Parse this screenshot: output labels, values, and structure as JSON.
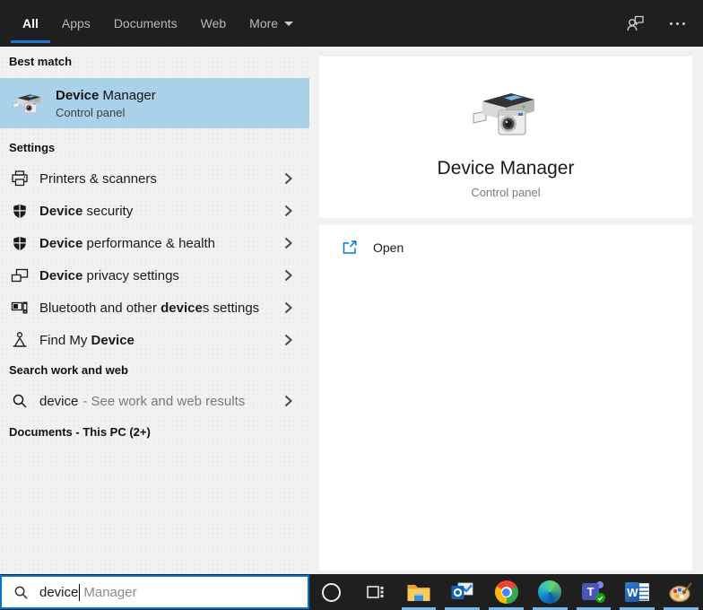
{
  "header": {
    "tabs": [
      {
        "label": "All"
      },
      {
        "label": "Apps"
      },
      {
        "label": "Documents"
      },
      {
        "label": "Web"
      },
      {
        "label": "More"
      }
    ]
  },
  "left_panel": {
    "best_match_label": "Best match",
    "best_match": {
      "title_bold": "Device",
      "title_rest": " Manager",
      "subtitle": "Control panel"
    },
    "settings_label": "Settings",
    "settings_items": [
      {
        "pre": "Printers & scanners",
        "bold": "",
        "post": ""
      },
      {
        "pre": "",
        "bold": "Device",
        "post": " security"
      },
      {
        "pre": "",
        "bold": "Device",
        "post": " performance & health"
      },
      {
        "pre": "",
        "bold": "Device",
        "post": " privacy settings"
      },
      {
        "pre": "Bluetooth and other ",
        "bold": "device",
        "post": "s settings"
      },
      {
        "pre": "Find My ",
        "bold": "Device",
        "post": ""
      }
    ],
    "web_search_label": "Search work and web",
    "web_search": {
      "query": "device",
      "rest": "- See work and web results"
    },
    "documents_label": "Documents - This PC (2+)"
  },
  "preview": {
    "title": "Device Manager",
    "subtitle": "Control panel",
    "open_label": "Open"
  },
  "search_box": {
    "typed": "device",
    "suggestion": "Manager"
  },
  "taskbar": {
    "teams_letter": "T",
    "word_letter": "W"
  },
  "colors": {
    "accent": "#0078d7",
    "highlight": "#a9d1ea",
    "running_indicator": "#76b9ed",
    "header_bg": "#1f1f1f"
  }
}
